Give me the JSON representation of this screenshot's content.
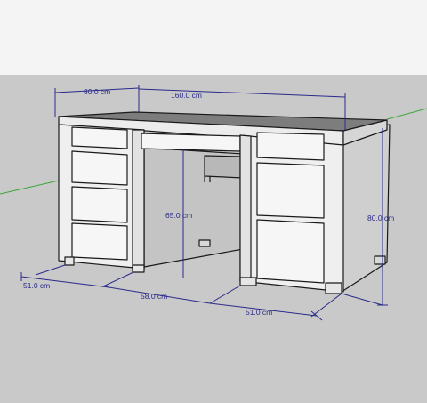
{
  "viewport": {
    "sky_color": "#f4f4f4",
    "ground_color": "#c9c9c9",
    "desk_light_color": "#ededed",
    "desk_side_color": "#cfcfcf",
    "desk_dark_color": "#7d7d7d",
    "edge_color": "#1a1a1a",
    "dimension_color": "#2a2a8a",
    "green_axis_color": "#3aa63a"
  },
  "dimensions": {
    "top_depth": "80.0 cm",
    "top_width": "160.0 cm",
    "kneehole_height": "65.0 cm",
    "total_height": "80.0 cm",
    "left_pedestal_width": "51.0 cm",
    "kneehole_width": "58.0 cm",
    "right_pedestal_width": "51.0 cm"
  }
}
